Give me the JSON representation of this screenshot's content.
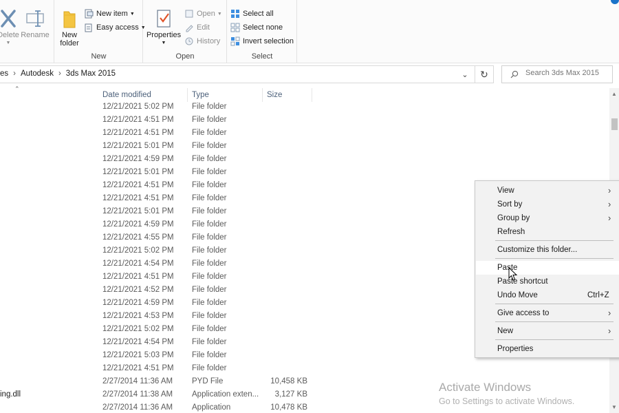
{
  "ribbon": {
    "organize": {
      "label": "",
      "delete_label": "Delete",
      "rename_label": "Rename"
    },
    "new": {
      "label": "New",
      "new_folder_label": "New folder",
      "new_item_label": "New item",
      "easy_access_label": "Easy access"
    },
    "open": {
      "label": "Open",
      "properties_label": "Properties",
      "open_label": "Open",
      "edit_label": "Edit",
      "history_label": "History"
    },
    "select": {
      "label": "Select",
      "select_all_label": "Select all",
      "select_none_label": "Select none",
      "invert_selection_label": "Invert selection"
    }
  },
  "address": {
    "crumbs": [
      "es",
      "Autodesk",
      "3ds Max 2015"
    ],
    "search_placeholder": "Search 3ds Max 2015"
  },
  "columns": {
    "date": "Date modified",
    "type": "Type",
    "size": "Size"
  },
  "rows": [
    {
      "name": "",
      "date": "12/21/2021 5:02 PM",
      "type": "File folder",
      "size": ""
    },
    {
      "name": "",
      "date": "12/21/2021 4:51 PM",
      "type": "File folder",
      "size": ""
    },
    {
      "name": "",
      "date": "12/21/2021 4:51 PM",
      "type": "File folder",
      "size": ""
    },
    {
      "name": "",
      "date": "12/21/2021 5:01 PM",
      "type": "File folder",
      "size": ""
    },
    {
      "name": "",
      "date": "12/21/2021 4:59 PM",
      "type": "File folder",
      "size": ""
    },
    {
      "name": "",
      "date": "12/21/2021 5:01 PM",
      "type": "File folder",
      "size": ""
    },
    {
      "name": "",
      "date": "12/21/2021 4:51 PM",
      "type": "File folder",
      "size": ""
    },
    {
      "name": "",
      "date": "12/21/2021 4:51 PM",
      "type": "File folder",
      "size": ""
    },
    {
      "name": "",
      "date": "12/21/2021 5:01 PM",
      "type": "File folder",
      "size": ""
    },
    {
      "name": "",
      "date": "12/21/2021 4:59 PM",
      "type": "File folder",
      "size": ""
    },
    {
      "name": "",
      "date": "12/21/2021 4:55 PM",
      "type": "File folder",
      "size": ""
    },
    {
      "name": "",
      "date": "12/21/2021 5:02 PM",
      "type": "File folder",
      "size": ""
    },
    {
      "name": "",
      "date": "12/21/2021 4:54 PM",
      "type": "File folder",
      "size": ""
    },
    {
      "name": "",
      "date": "12/21/2021 4:51 PM",
      "type": "File folder",
      "size": ""
    },
    {
      "name": "",
      "date": "12/21/2021 4:52 PM",
      "type": "File folder",
      "size": ""
    },
    {
      "name": "",
      "date": "12/21/2021 4:59 PM",
      "type": "File folder",
      "size": ""
    },
    {
      "name": "",
      "date": "12/21/2021 4:53 PM",
      "type": "File folder",
      "size": ""
    },
    {
      "name": "",
      "date": "12/21/2021 5:02 PM",
      "type": "File folder",
      "size": ""
    },
    {
      "name": "",
      "date": "12/21/2021 4:54 PM",
      "type": "File folder",
      "size": ""
    },
    {
      "name": "",
      "date": "12/21/2021 5:03 PM",
      "type": "File folder",
      "size": ""
    },
    {
      "name": "",
      "date": "12/21/2021 4:51 PM",
      "type": "File folder",
      "size": ""
    },
    {
      "name": "",
      "date": "2/27/2014 11:36 AM",
      "type": "PYD File",
      "size": "10,458 KB"
    },
    {
      "name": "ing.dll",
      "date": "2/27/2014 11:38 AM",
      "type": "Application exten...",
      "size": "3,127 KB"
    },
    {
      "name": "",
      "date": "2/27/2014 11:36 AM",
      "type": "Application",
      "size": "10,478 KB"
    }
  ],
  "context_menu": {
    "view": "View",
    "sort_by": "Sort by",
    "group_by": "Group by",
    "refresh": "Refresh",
    "customize": "Customize this folder...",
    "paste": "Paste",
    "paste_shortcut": "Paste shortcut",
    "undo_move": "Undo Move",
    "undo_shortcut": "Ctrl+Z",
    "give_access": "Give access to",
    "new": "New",
    "properties": "Properties"
  },
  "watermark": {
    "line1": "Activate Windows",
    "line2": "Go to Settings to activate Windows."
  },
  "colors": {
    "accent": "#1a73c9",
    "column_header": "#4c607a",
    "menu_bg": "#f2f2f2"
  }
}
